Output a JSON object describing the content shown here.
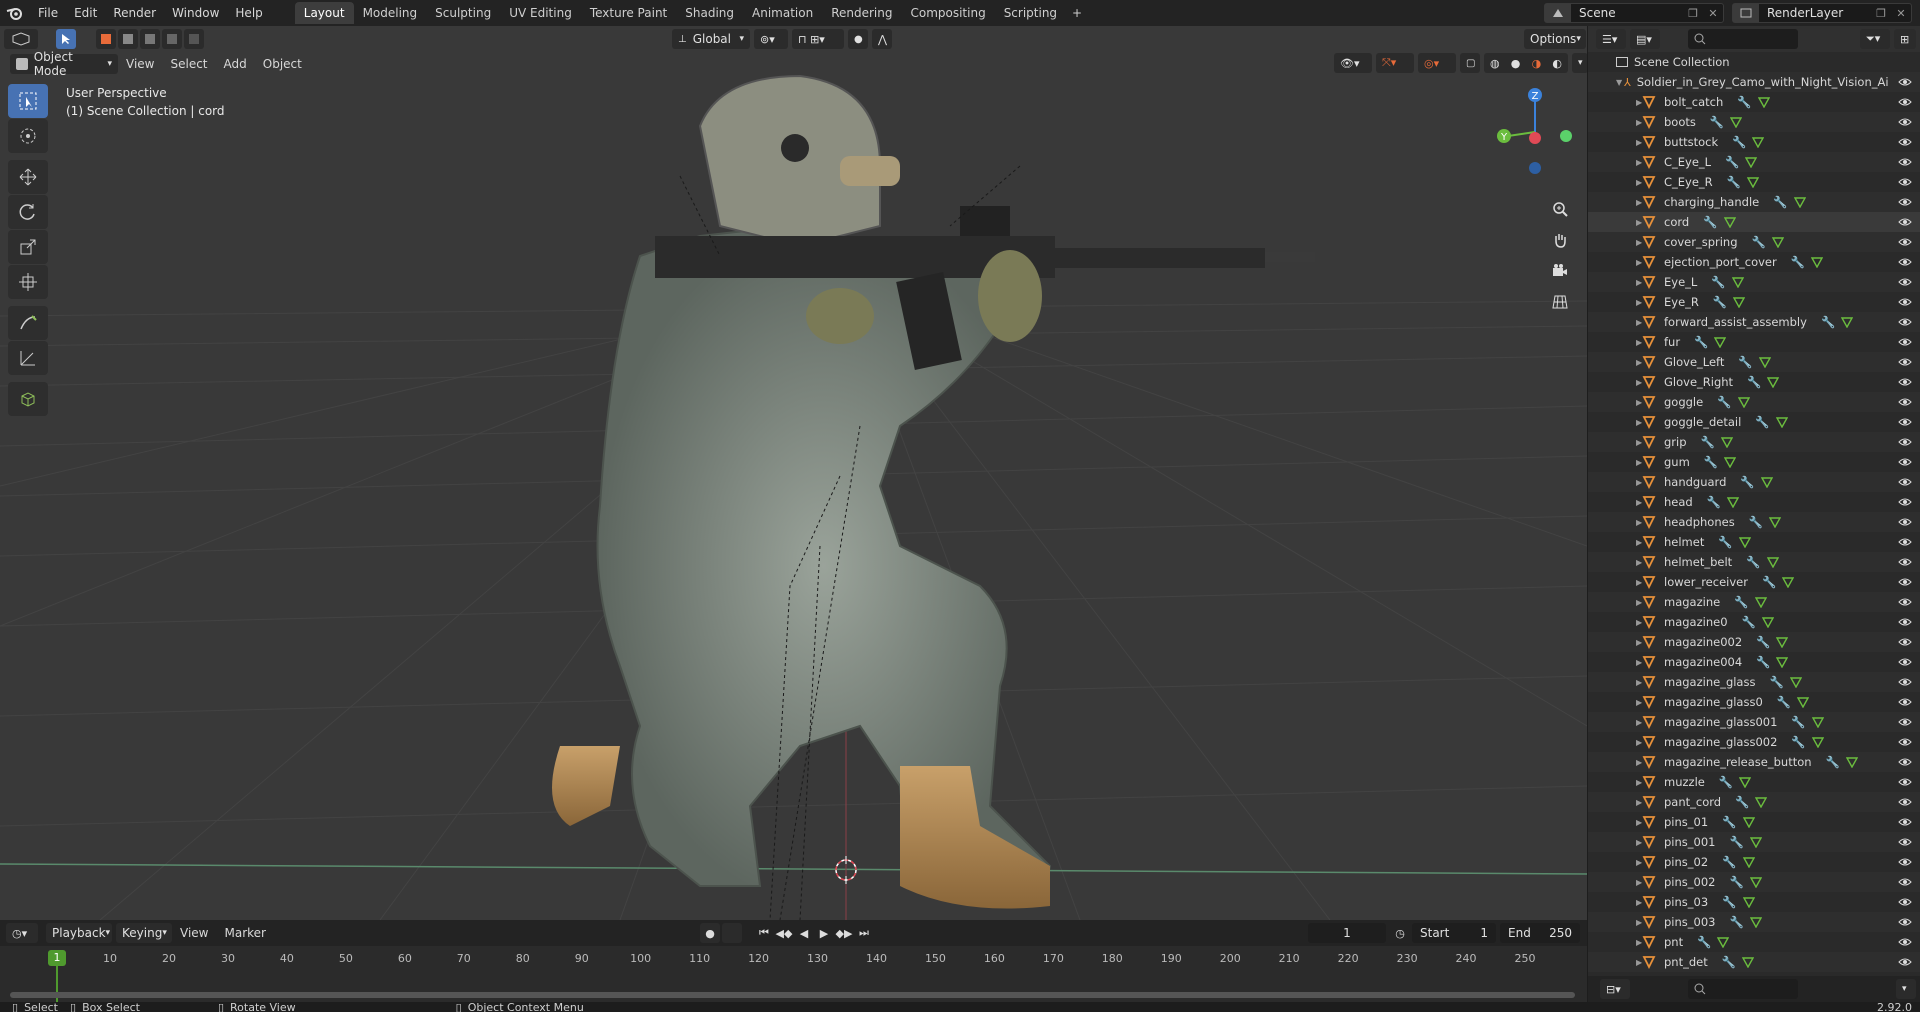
{
  "top_menu": [
    "File",
    "Edit",
    "Render",
    "Window",
    "Help"
  ],
  "workspaces": [
    "Layout",
    "Modeling",
    "Sculpting",
    "UV Editing",
    "Texture Paint",
    "Shading",
    "Animation",
    "Rendering",
    "Compositing",
    "Scripting"
  ],
  "active_workspace": "Layout",
  "scene_name": "Scene",
  "view_layer": "RenderLayer",
  "viewport": {
    "mode": "Object Mode",
    "menus": [
      "View",
      "Select",
      "Add",
      "Object"
    ],
    "transform_orientation": "Global",
    "options_label": "Options",
    "overlay_title": "User Perspective",
    "overlay_subtitle": "(1) Scene Collection | cord",
    "gizmo_axes": {
      "z": "Z",
      "y": "Y"
    }
  },
  "timeline": {
    "menus": [
      "Playback",
      "Keying",
      "View",
      "Marker"
    ],
    "current_frame": "1",
    "start_label": "Start",
    "start_value": "1",
    "end_label": "End",
    "end_value": "250",
    "ruler_marks": [
      "1",
      "10",
      "20",
      "30",
      "40",
      "50",
      "60",
      "70",
      "80",
      "90",
      "100",
      "110",
      "120",
      "130",
      "140",
      "150",
      "160",
      "170",
      "180",
      "190",
      "200",
      "210",
      "220",
      "230",
      "240",
      "250"
    ]
  },
  "status_bar": {
    "select": "Select",
    "box_select": "Box Select",
    "rotate_view": "Rotate View",
    "context_menu": "Object Context Menu",
    "version": "2.92.0"
  },
  "outliner": {
    "root": "Scene Collection",
    "armature": "Soldier_in_Grey_Camo_with_Night_Vision_Ai",
    "items": [
      "bolt_catch",
      "boots",
      "buttstock",
      "C_Eye_L",
      "C_Eye_R",
      "charging_handle",
      "cord",
      "cover_spring",
      "ejection_port_cover",
      "Eye_L",
      "Eye_R",
      "forward_assist_assembly",
      "fur",
      "Glove_Left",
      "Glove_Right",
      "goggle",
      "goggle_detail",
      "grip",
      "gum",
      "handguard",
      "head",
      "headphones",
      "helmet",
      "helmet_belt",
      "lower_receiver",
      "magazine",
      "magazine0",
      "magazine002",
      "magazine004",
      "magazine_glass",
      "magazine_glass0",
      "magazine_glass001",
      "magazine_glass002",
      "magazine_release_button",
      "muzzle",
      "pant_cord",
      "pins_01",
      "pins_001",
      "pins_02",
      "pins_002",
      "pins_03",
      "pins_003",
      "pnt",
      "pnt_det"
    ],
    "selected": "cord"
  },
  "colors": {
    "accent": "#4772b3",
    "mesh_icon": "#e8913a",
    "axis_x": "#e04a56",
    "axis_y": "#6bbd3e",
    "axis_z": "#3b82db"
  }
}
